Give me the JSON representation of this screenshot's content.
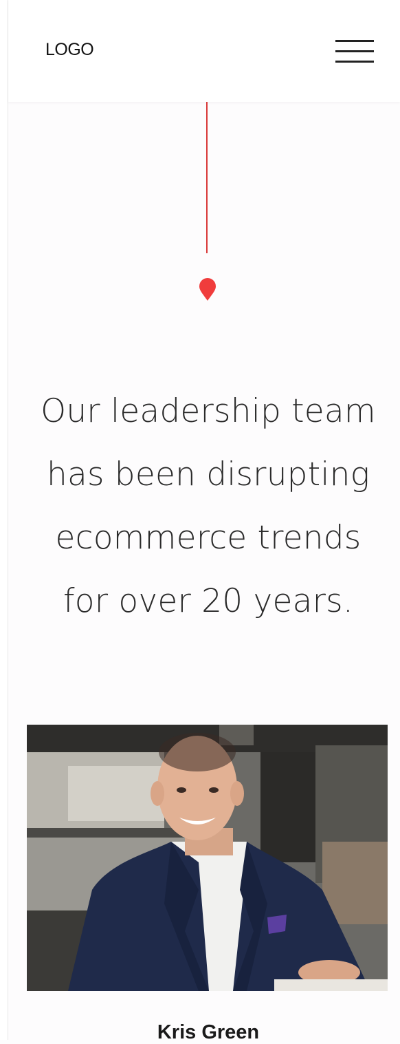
{
  "header": {
    "logo_text": "LOGO",
    "menu_icon": "hamburger-menu-icon"
  },
  "hero": {
    "pin_icon": "map-pin-icon",
    "headline_lines": [
      "Our leadership team",
      "has been disrupting",
      "ecommerce trends",
      "for over 20 years."
    ]
  },
  "team": {
    "members": [
      {
        "name": "Kris Green"
      }
    ]
  },
  "colors": {
    "accent": "#e63b3b",
    "text": "#2a2a2a",
    "background": "#fdfcfd"
  }
}
